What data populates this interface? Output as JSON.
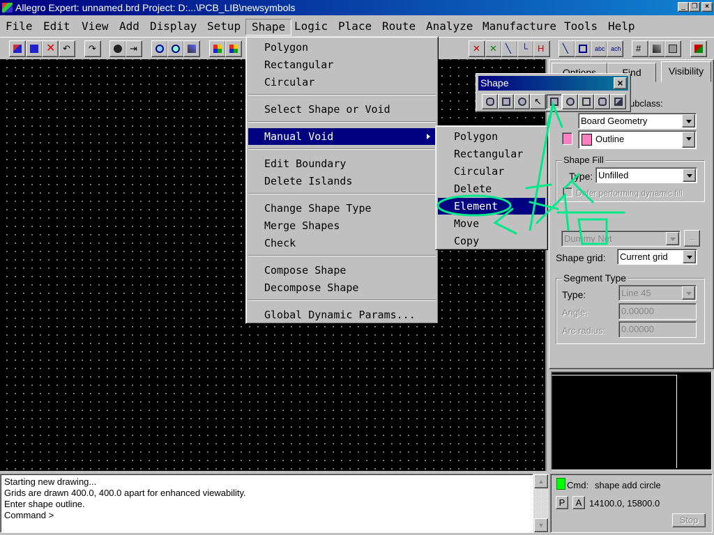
{
  "window": {
    "title": "Allegro Expert: unnamed.brd  Project: D:...\\PCB_LIB\\newsymbols",
    "controls": [
      "minimize",
      "restore",
      "close"
    ]
  },
  "menubar": [
    "File",
    "Edit",
    "View",
    "Add",
    "Display",
    "Setup",
    "Shape",
    "Logic",
    "Place",
    "Route",
    "Analyze",
    "Manufacture",
    "Tools",
    "Help"
  ],
  "shape_menu": {
    "items": [
      "Polygon",
      "Rectangular",
      "Circular",
      "Select Shape or Void",
      "Manual Void",
      "Edit Boundary",
      "Delete Islands",
      "Change Shape Type",
      "Merge Shapes",
      "Check",
      "Compose Shape",
      "Decompose Shape",
      "Global Dynamic Params..."
    ],
    "highlighted": "Manual Void"
  },
  "manual_void_submenu": {
    "items": [
      "Polygon",
      "Rectangular",
      "Circular",
      "Delete",
      "Element",
      "Move",
      "Copy"
    ],
    "highlighted": "Element"
  },
  "shape_toolbar": {
    "title": "Shape"
  },
  "right_panel": {
    "tabs": [
      "Options",
      "Find",
      "Visibility"
    ],
    "subclass_label": "ubclass:",
    "class_value": "Board Geometry",
    "subclass_value": "Outline",
    "subclass_color": "#ff80c0",
    "shape_fill": {
      "title": "Shape Fill",
      "type_label": "Type:",
      "type_value": "Unfilled",
      "defer_label": "Defer performing dynamic fill"
    },
    "net_value": "Dummy Net",
    "net_browse": "...",
    "shape_grid_label": "Shape grid:",
    "shape_grid_value": "Current grid",
    "segment": {
      "title": "Segment Type",
      "type_label": "Type:",
      "type_value": "Line 45",
      "angle_label": "Angle:",
      "angle_value": "0.00000",
      "arc_label": "Arc radius:",
      "arc_value": "0.00000"
    }
  },
  "command_log": [
    "Starting new drawing...",
    "Grids are drawn 400.0, 400.0 apart for enhanced viewability.",
    "Enter shape outline.",
    "Command >"
  ],
  "status": {
    "cmd_label": "Cmd:",
    "cmd_value": "shape add circle",
    "p": "P",
    "a": "A",
    "coords": "14100.0, 15800.0",
    "stop": "Stop",
    "indicator_color": "#00ff00"
  }
}
